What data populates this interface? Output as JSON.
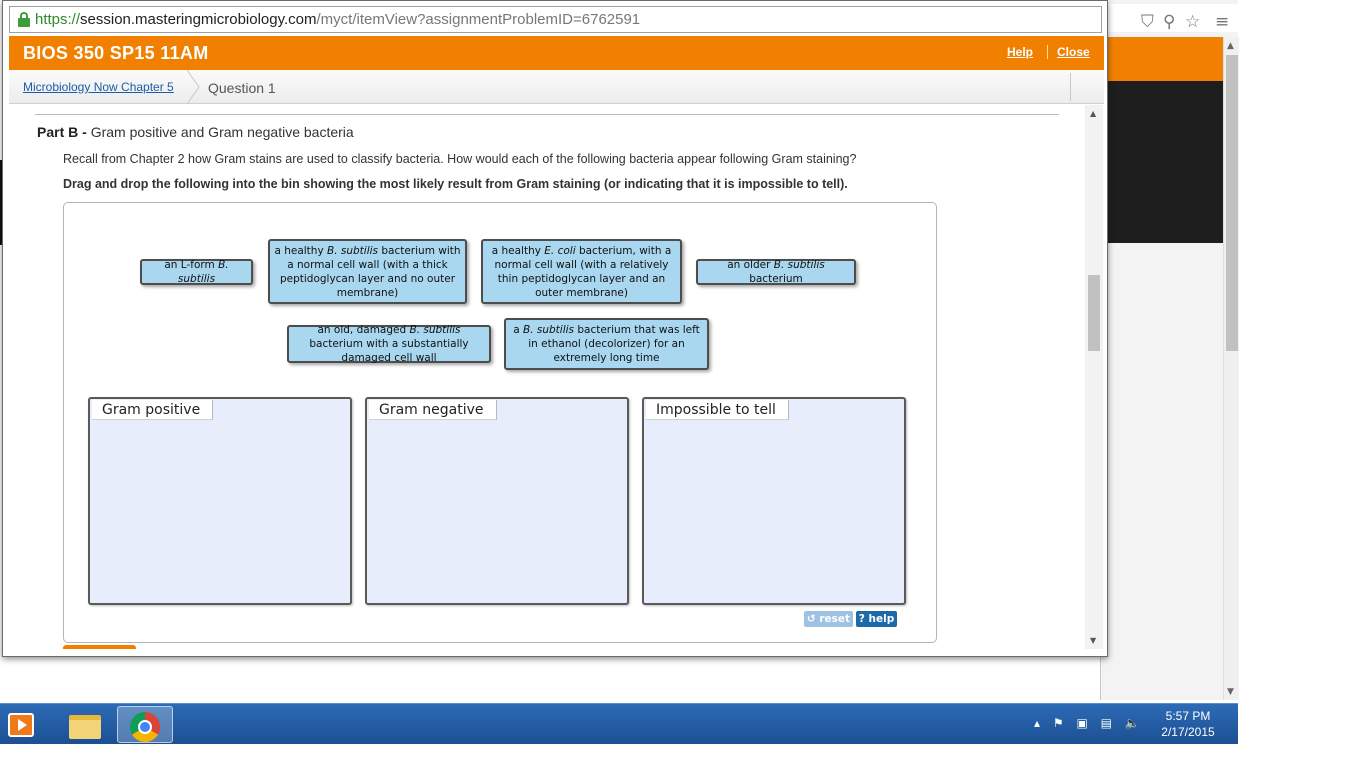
{
  "browser": {
    "url": {
      "scheme": "https://",
      "host": "session.masteringmicrobiology.com",
      "path": "/myct/itemView?assignmentProblemID=6762591"
    }
  },
  "header": {
    "course_title": "BIOS 350 SP15 11AM",
    "help_label": "Help",
    "close_label": "Close"
  },
  "breadcrumb": {
    "parent": "Microbiology Now Chapter 5",
    "current": "Question 1"
  },
  "part": {
    "label": "Part B -",
    "title": "Gram positive and Gram negative bacteria",
    "question": "Recall from Chapter 2 how Gram stains are used to classify bacteria. How would each of the following bacteria appear following Gram staining?",
    "instruction": "Drag and drop the following into the bin showing the most likely result from Gram staining (or indicating that it is impossible to tell)."
  },
  "labels": [
    {
      "pre": "an L-form ",
      "italic": "B. subtilis",
      "post": ""
    },
    {
      "pre": "a healthy ",
      "italic": "B. subtilis",
      "post": " bacterium with a normal cell wall (with a thick peptidoglycan layer and no outer membrane)"
    },
    {
      "pre": "a healthy ",
      "italic": "E. coli",
      "post": " bacterium, with a normal cell wall (with a relatively thin peptidoglycan layer and an outer membrane)"
    },
    {
      "pre": "an older ",
      "italic": "B. subtilis",
      "post": " bacterium"
    },
    {
      "pre": "an old, damaged ",
      "italic": "B. subtilis",
      "post": " bacterium with a substantially damaged cell wall"
    },
    {
      "pre": "a ",
      "italic": "B. subtilis",
      "post": " bacterium that was left in ethanol (decolorizer) for an extremely long time"
    }
  ],
  "bins": [
    {
      "title": "Gram positive"
    },
    {
      "title": "Gram negative"
    },
    {
      "title": "Impossible to tell"
    }
  ],
  "controls": {
    "reset_label": "reset",
    "help_label": "help"
  },
  "taskbar": {
    "time": "5:57 PM",
    "date": "2/17/2015"
  },
  "colors": {
    "header_orange": "#f28000",
    "label_tile": "#a8d7ef",
    "bin_fill": "#e8edfb",
    "link_blue": "#1a5ea8"
  }
}
